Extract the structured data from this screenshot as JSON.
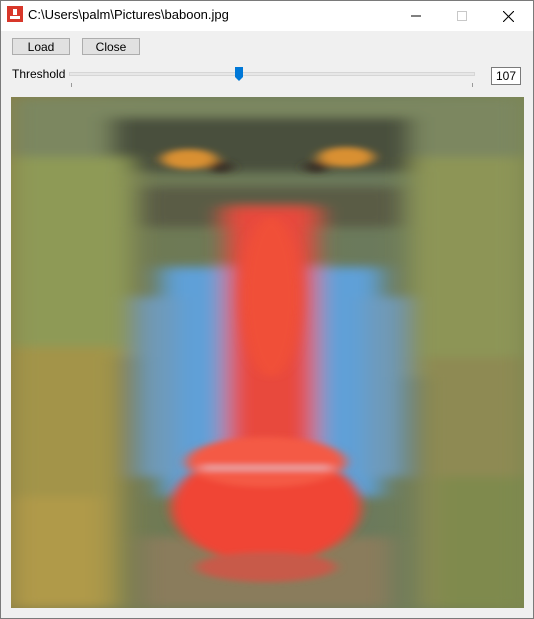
{
  "window": {
    "title": "C:\\Users\\palm\\Pictures\\baboon.jpg"
  },
  "icons": {
    "app": "app-icon",
    "minimize": "minimize-icon",
    "maximize": "maximize-icon",
    "close": "close-icon"
  },
  "toolbar": {
    "load_label": "Load",
    "close_label": "Close"
  },
  "threshold": {
    "label": "Threshold",
    "value": "107",
    "min": 0,
    "max": 255
  },
  "image": {
    "description_name": "baboon"
  },
  "colors": {
    "accent": "#0078d7",
    "titlebar": "#ffffff",
    "client": "#f0f0f0"
  }
}
